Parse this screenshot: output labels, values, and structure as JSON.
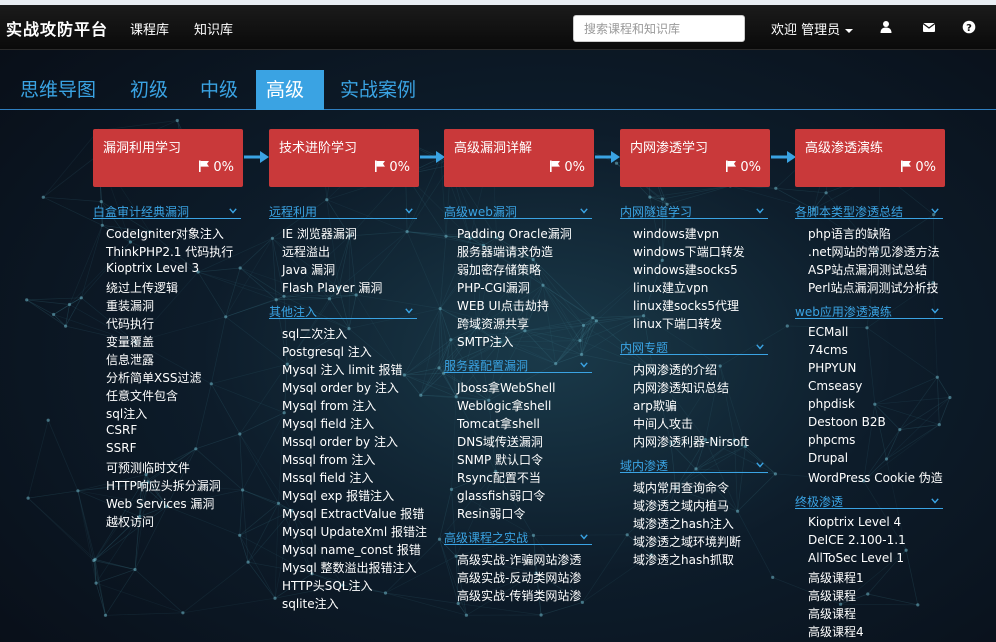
{
  "navbar": {
    "brand": "实战攻防平台",
    "links": [
      "课程库",
      "知识库"
    ],
    "search_placeholder": "搜索课程和知识库",
    "welcome": "欢迎 管理员",
    "icons": [
      "user-icon",
      "envelope-icon",
      "question-icon"
    ]
  },
  "tabs": {
    "items": [
      "思维导图",
      "初级",
      "中级",
      "高级",
      "实战案例"
    ],
    "active": "高级"
  },
  "stages": [
    {
      "title": "漏洞利用学习",
      "progress": "0%"
    },
    {
      "title": "技术进阶学习",
      "progress": "0%"
    },
    {
      "title": "高级漏洞详解",
      "progress": "0%"
    },
    {
      "title": "内网渗透学习",
      "progress": "0%"
    },
    {
      "title": "高级渗透演练",
      "progress": "0%"
    }
  ],
  "columns": [
    {
      "groups": [
        {
          "title": "白盒审计经典漏洞",
          "items": [
            "CodeIgniter对象注入",
            "ThinkPHP2.1 代码执行",
            "Kioptrix Level 3",
            "绕过上传逻辑",
            "重装漏洞",
            "代码执行",
            "变量覆盖",
            "信息泄露",
            "分析简单XSS过滤",
            "任意文件包含",
            "sql注入",
            "CSRF",
            "SSRF",
            "可预测临时文件",
            "HTTP响应头拆分漏洞",
            "Web Services 漏洞",
            "越权访问"
          ]
        }
      ]
    },
    {
      "groups": [
        {
          "title": "远程利用",
          "items": [
            "IE 浏览器漏洞",
            "远程溢出",
            "Java 漏洞",
            "Flash Player 漏洞"
          ]
        },
        {
          "title": "其他注入",
          "items": [
            "sql二次注入",
            "Postgresql 注入",
            "Mysql 注入 limit 报错",
            "Mysql order by 注入",
            "Mysql from 注入",
            "Mysql field 注入",
            "Mssql order by 注入",
            "Mssql from 注入",
            "Mssql field 注入",
            "Mysql exp 报错注入",
            "Mysql ExtractValue 报错",
            "Mysql UpdateXml 报错注",
            "Mysql name_const 报错",
            "Mysql 整数溢出报错注入",
            "HTTP头SQL注入",
            "sqlite注入"
          ]
        }
      ]
    },
    {
      "groups": [
        {
          "title": "高级web漏洞",
          "items": [
            "Padding Oracle漏洞",
            "服务器端请求伪造",
            "弱加密存储策略",
            "PHP-CGI漏洞",
            "WEB UI点击劫持",
            "跨域资源共享",
            "SMTP注入"
          ]
        },
        {
          "title": "服务器配置漏洞",
          "items": [
            "Jboss拿WebShell",
            "Weblogic拿shell",
            "Tomcat拿shell",
            "DNS域传送漏洞",
            "SNMP 默认口令",
            "Rsync配置不当",
            "glassfish弱口令",
            "Resin弱口令"
          ]
        },
        {
          "title": "高级课程之实战",
          "items": [
            "高级实战-诈骗网站渗透",
            "高级实战-反动类网站渗",
            "高级实战-传销类网站渗"
          ]
        }
      ]
    },
    {
      "groups": [
        {
          "title": "内网隧道学习",
          "items": [
            "windows建vpn",
            "windows下端口转发",
            "windows建socks5",
            "linux建立vpn",
            "linux建socks5代理",
            "linux下端口转发"
          ]
        },
        {
          "title": "内网专题",
          "items": [
            "内网渗透的介绍",
            "内网渗透知识总结",
            "arp欺骗",
            "中间人攻击",
            "内网渗透利器-Nirsoft"
          ]
        },
        {
          "title": "域内渗透",
          "items": [
            "域内常用查询命令",
            "域渗透之域内植马",
            "域渗透之hash注入",
            "域渗透之域环境判断",
            "域渗透之hash抓取"
          ]
        }
      ]
    },
    {
      "groups": [
        {
          "title": "各脚本类型渗透总结",
          "items": [
            "php语言的缺陷",
            ".net网站的常见渗透方法",
            "ASP站点漏洞测试总结",
            "Perl站点漏洞测试分析技"
          ]
        },
        {
          "title": "web应用渗透演练",
          "items": [
            "ECMall",
            "74cms",
            "PHPYUN",
            "Cmseasy",
            "phpdisk",
            "Destoon B2B",
            "phpcms",
            "Drupal",
            "WordPress Cookie 伪造"
          ]
        },
        {
          "title": "终极渗透",
          "items": [
            "Kioptrix Level 4",
            "DeICE 2.100-1.1",
            "AllToSec Level 1",
            "高级课程1",
            "高级课程",
            "高级课程",
            "高级课程4"
          ]
        }
      ]
    }
  ],
  "colors": {
    "accent": "#3aa3e3",
    "stage": "#c9393a",
    "navbar": "#111111"
  }
}
